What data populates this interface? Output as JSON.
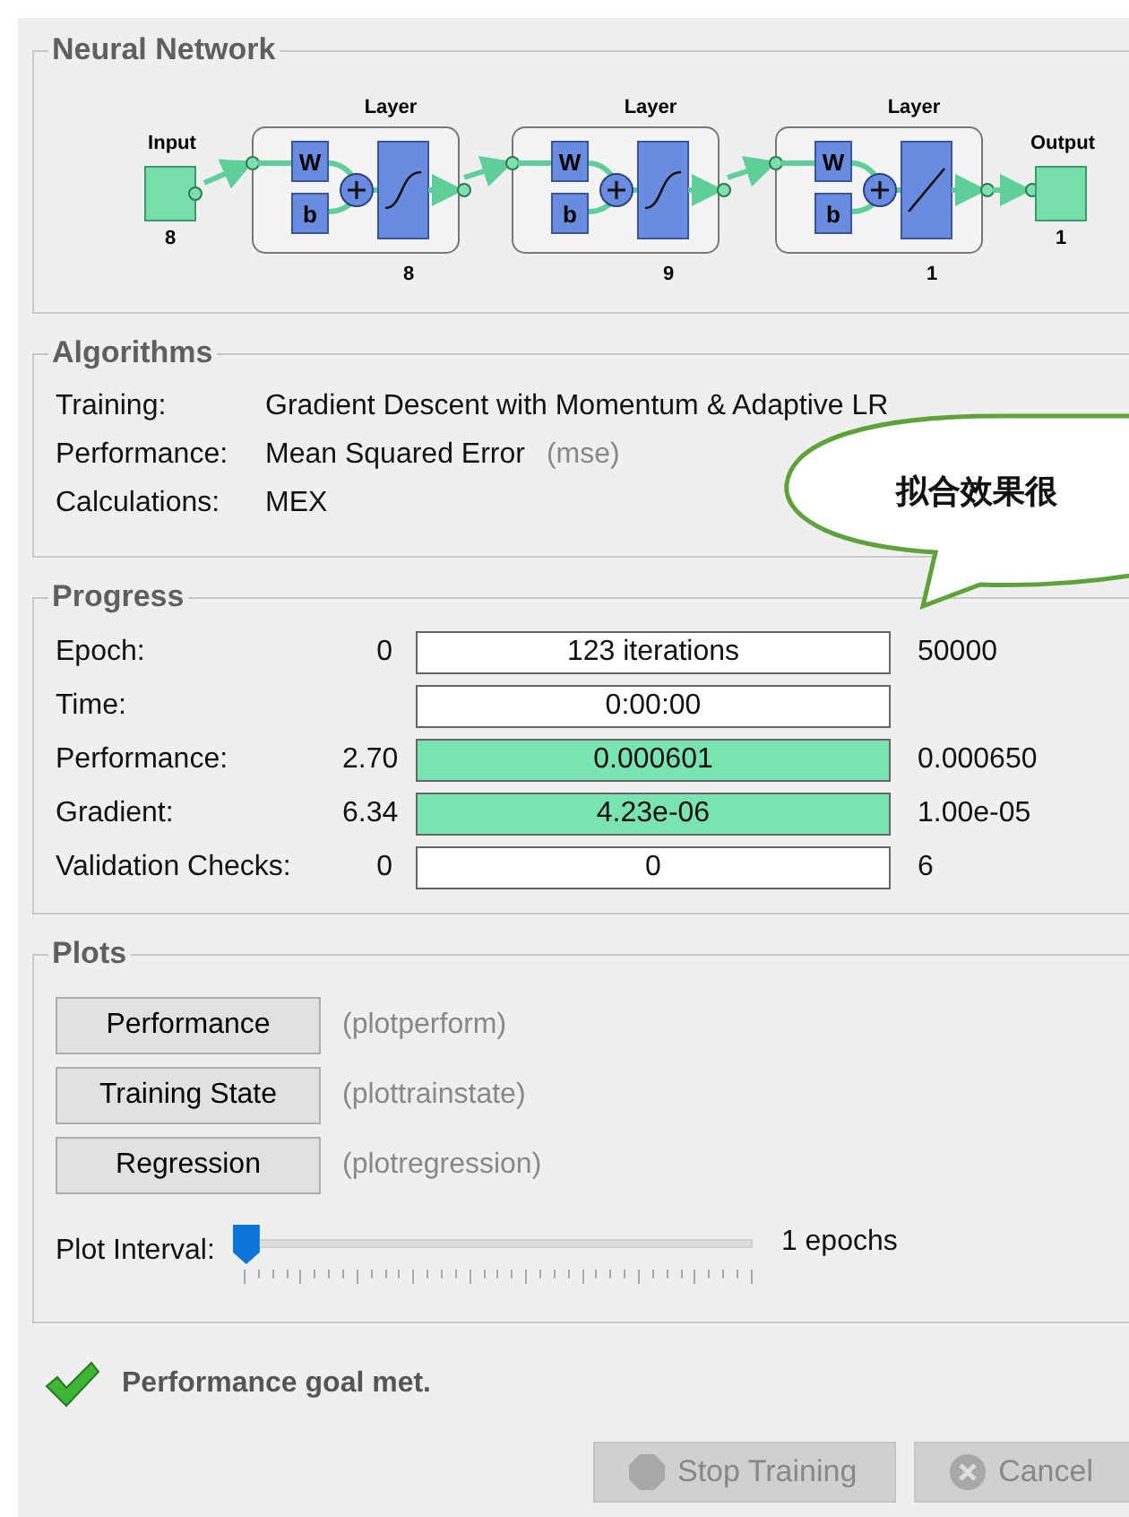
{
  "network": {
    "title": "Neural Network",
    "input": {
      "label": "Input",
      "size": "8"
    },
    "output": {
      "label": "Output",
      "size": "1"
    },
    "layers": [
      {
        "title": "Layer",
        "weight": "W",
        "bias": "b",
        "size": "8",
        "kind": "sigmoid"
      },
      {
        "title": "Layer",
        "weight": "W",
        "bias": "b",
        "size": "9",
        "kind": "sigmoid"
      },
      {
        "title": "Layer",
        "weight": "W",
        "bias": "b",
        "size": "1",
        "kind": "linear"
      }
    ]
  },
  "algorithms": {
    "title": "Algorithms",
    "rows": [
      {
        "label": "Training:",
        "value": "Gradient Descent with Momentum & Adaptive LR"
      },
      {
        "label": "Performance:",
        "value": "Mean Squared Error",
        "note": "(mse)"
      },
      {
        "label": "Calculations:",
        "value": "MEX"
      }
    ]
  },
  "callout": {
    "text": "拟合效果很"
  },
  "progress": {
    "title": "Progress",
    "rows": [
      {
        "label": "Epoch:",
        "start": "0",
        "value": "123 iterations",
        "level": 0,
        "end": "50000"
      },
      {
        "label": "Time:",
        "value": "0:00:00",
        "level": 0
      },
      {
        "label": "Performance:",
        "start": "2.70",
        "value": "0.000601",
        "level": 1,
        "end": "0.000650"
      },
      {
        "label": "Gradient:",
        "start": "6.34",
        "value": "4.23e-06",
        "level": 1,
        "end": "1.00e-05"
      },
      {
        "label": "Validation Checks:",
        "start": "0",
        "value": "0",
        "level": 0,
        "end": "6"
      }
    ]
  },
  "plots": {
    "title": "Plots",
    "buttons": [
      {
        "label": "Performance",
        "note": "(plotperform)"
      },
      {
        "label": "Training State",
        "note": "(plottrainstate)"
      },
      {
        "label": "Regression",
        "note": "(plotregression)"
      }
    ],
    "interval": {
      "label": "Plot Interval:",
      "level": 0,
      "reading": "1 epochs"
    }
  },
  "status": {
    "text": "Performance goal met."
  },
  "buttons": [
    {
      "label": "Stop Training",
      "kind": "stop",
      "disabled": true
    },
    {
      "label": "Cancel",
      "kind": "cancel",
      "disabled": true
    }
  ]
}
